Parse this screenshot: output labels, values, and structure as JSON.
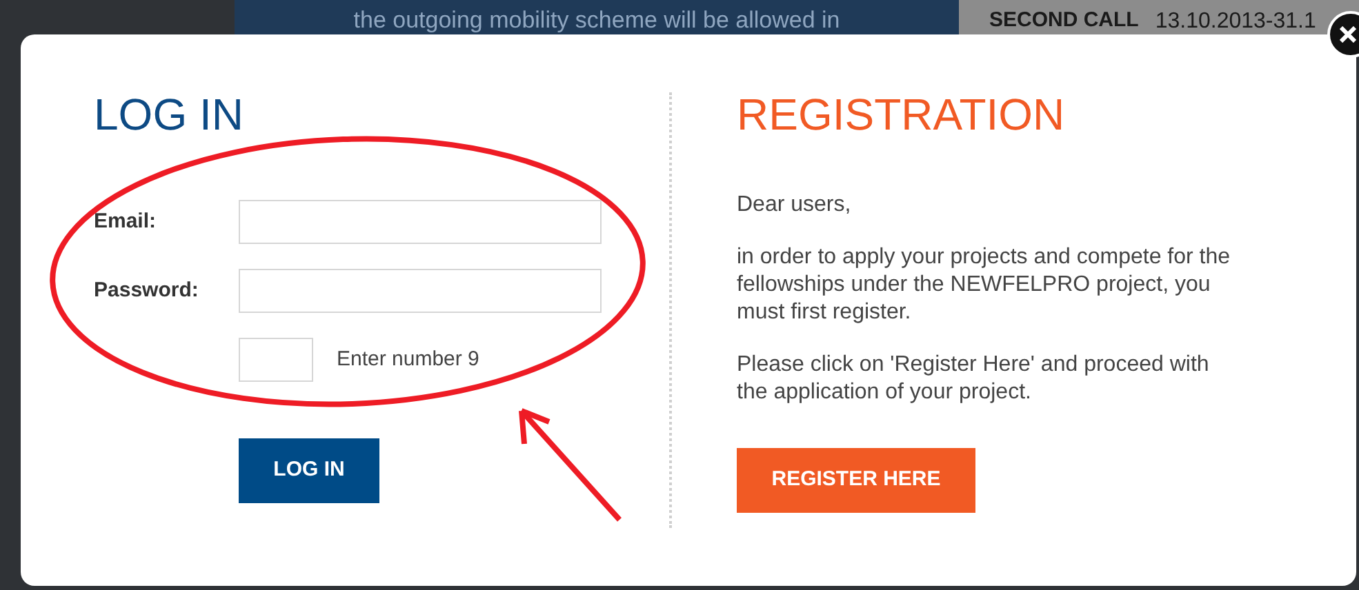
{
  "background": {
    "banner_text": "the outgoing mobility scheme will be allowed in",
    "call_label": "SECOND CALL",
    "call_dates": "13.10.2013-31.1"
  },
  "login": {
    "title": "LOG IN",
    "fields": [
      {
        "kind": "wide",
        "label": "Email:"
      },
      {
        "kind": "wide",
        "label": "Password:"
      },
      {
        "kind": "captcha",
        "hint": "Enter number 9"
      }
    ],
    "button": "LOG IN"
  },
  "registration": {
    "title": "REGISTRATION",
    "paragraphs": [
      "Dear users,",
      "in order to apply your projects and compete for the fellowships under the NEWFELPRO project, you must first register.",
      "Please click on 'Register Here' and proceed with the application of your project."
    ],
    "button": "REGISTER HERE"
  }
}
